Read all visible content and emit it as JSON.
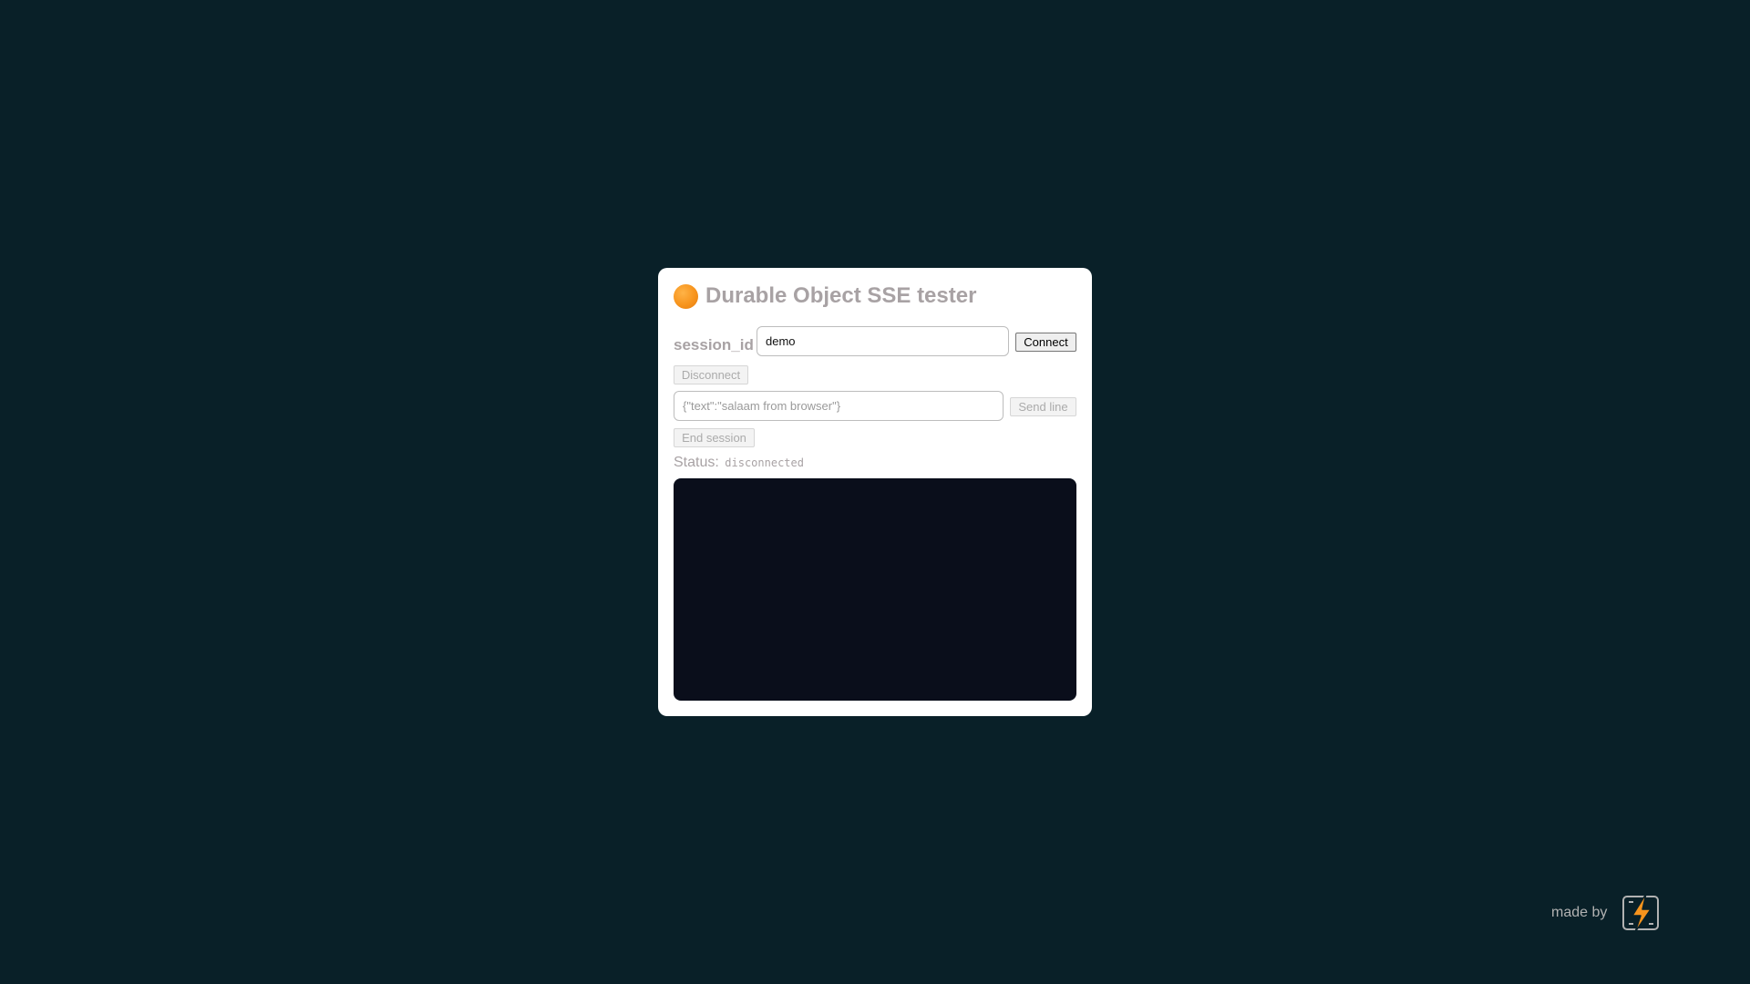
{
  "page": {
    "title": "Durable Object SSE tester",
    "title_icon": "orange-circle-icon"
  },
  "session": {
    "label": "session_id",
    "value": "demo",
    "connect_label": "Connect",
    "disconnect_label": "Disconnect"
  },
  "line": {
    "value": "{\"text\":\"salaam from browser\"}",
    "send_label": "Send line"
  },
  "end_session_label": "End session",
  "status": {
    "label": "Status:",
    "value": "disconnected"
  },
  "footer": {
    "made_by": "made by",
    "logo_icon": "lightning-bolt-logo-icon"
  },
  "colors": {
    "background": "#092028",
    "card": "#ffffff",
    "log_background": "#0a0e1b",
    "muted_text": "#a8a2a4",
    "accent": "#f7941d"
  }
}
